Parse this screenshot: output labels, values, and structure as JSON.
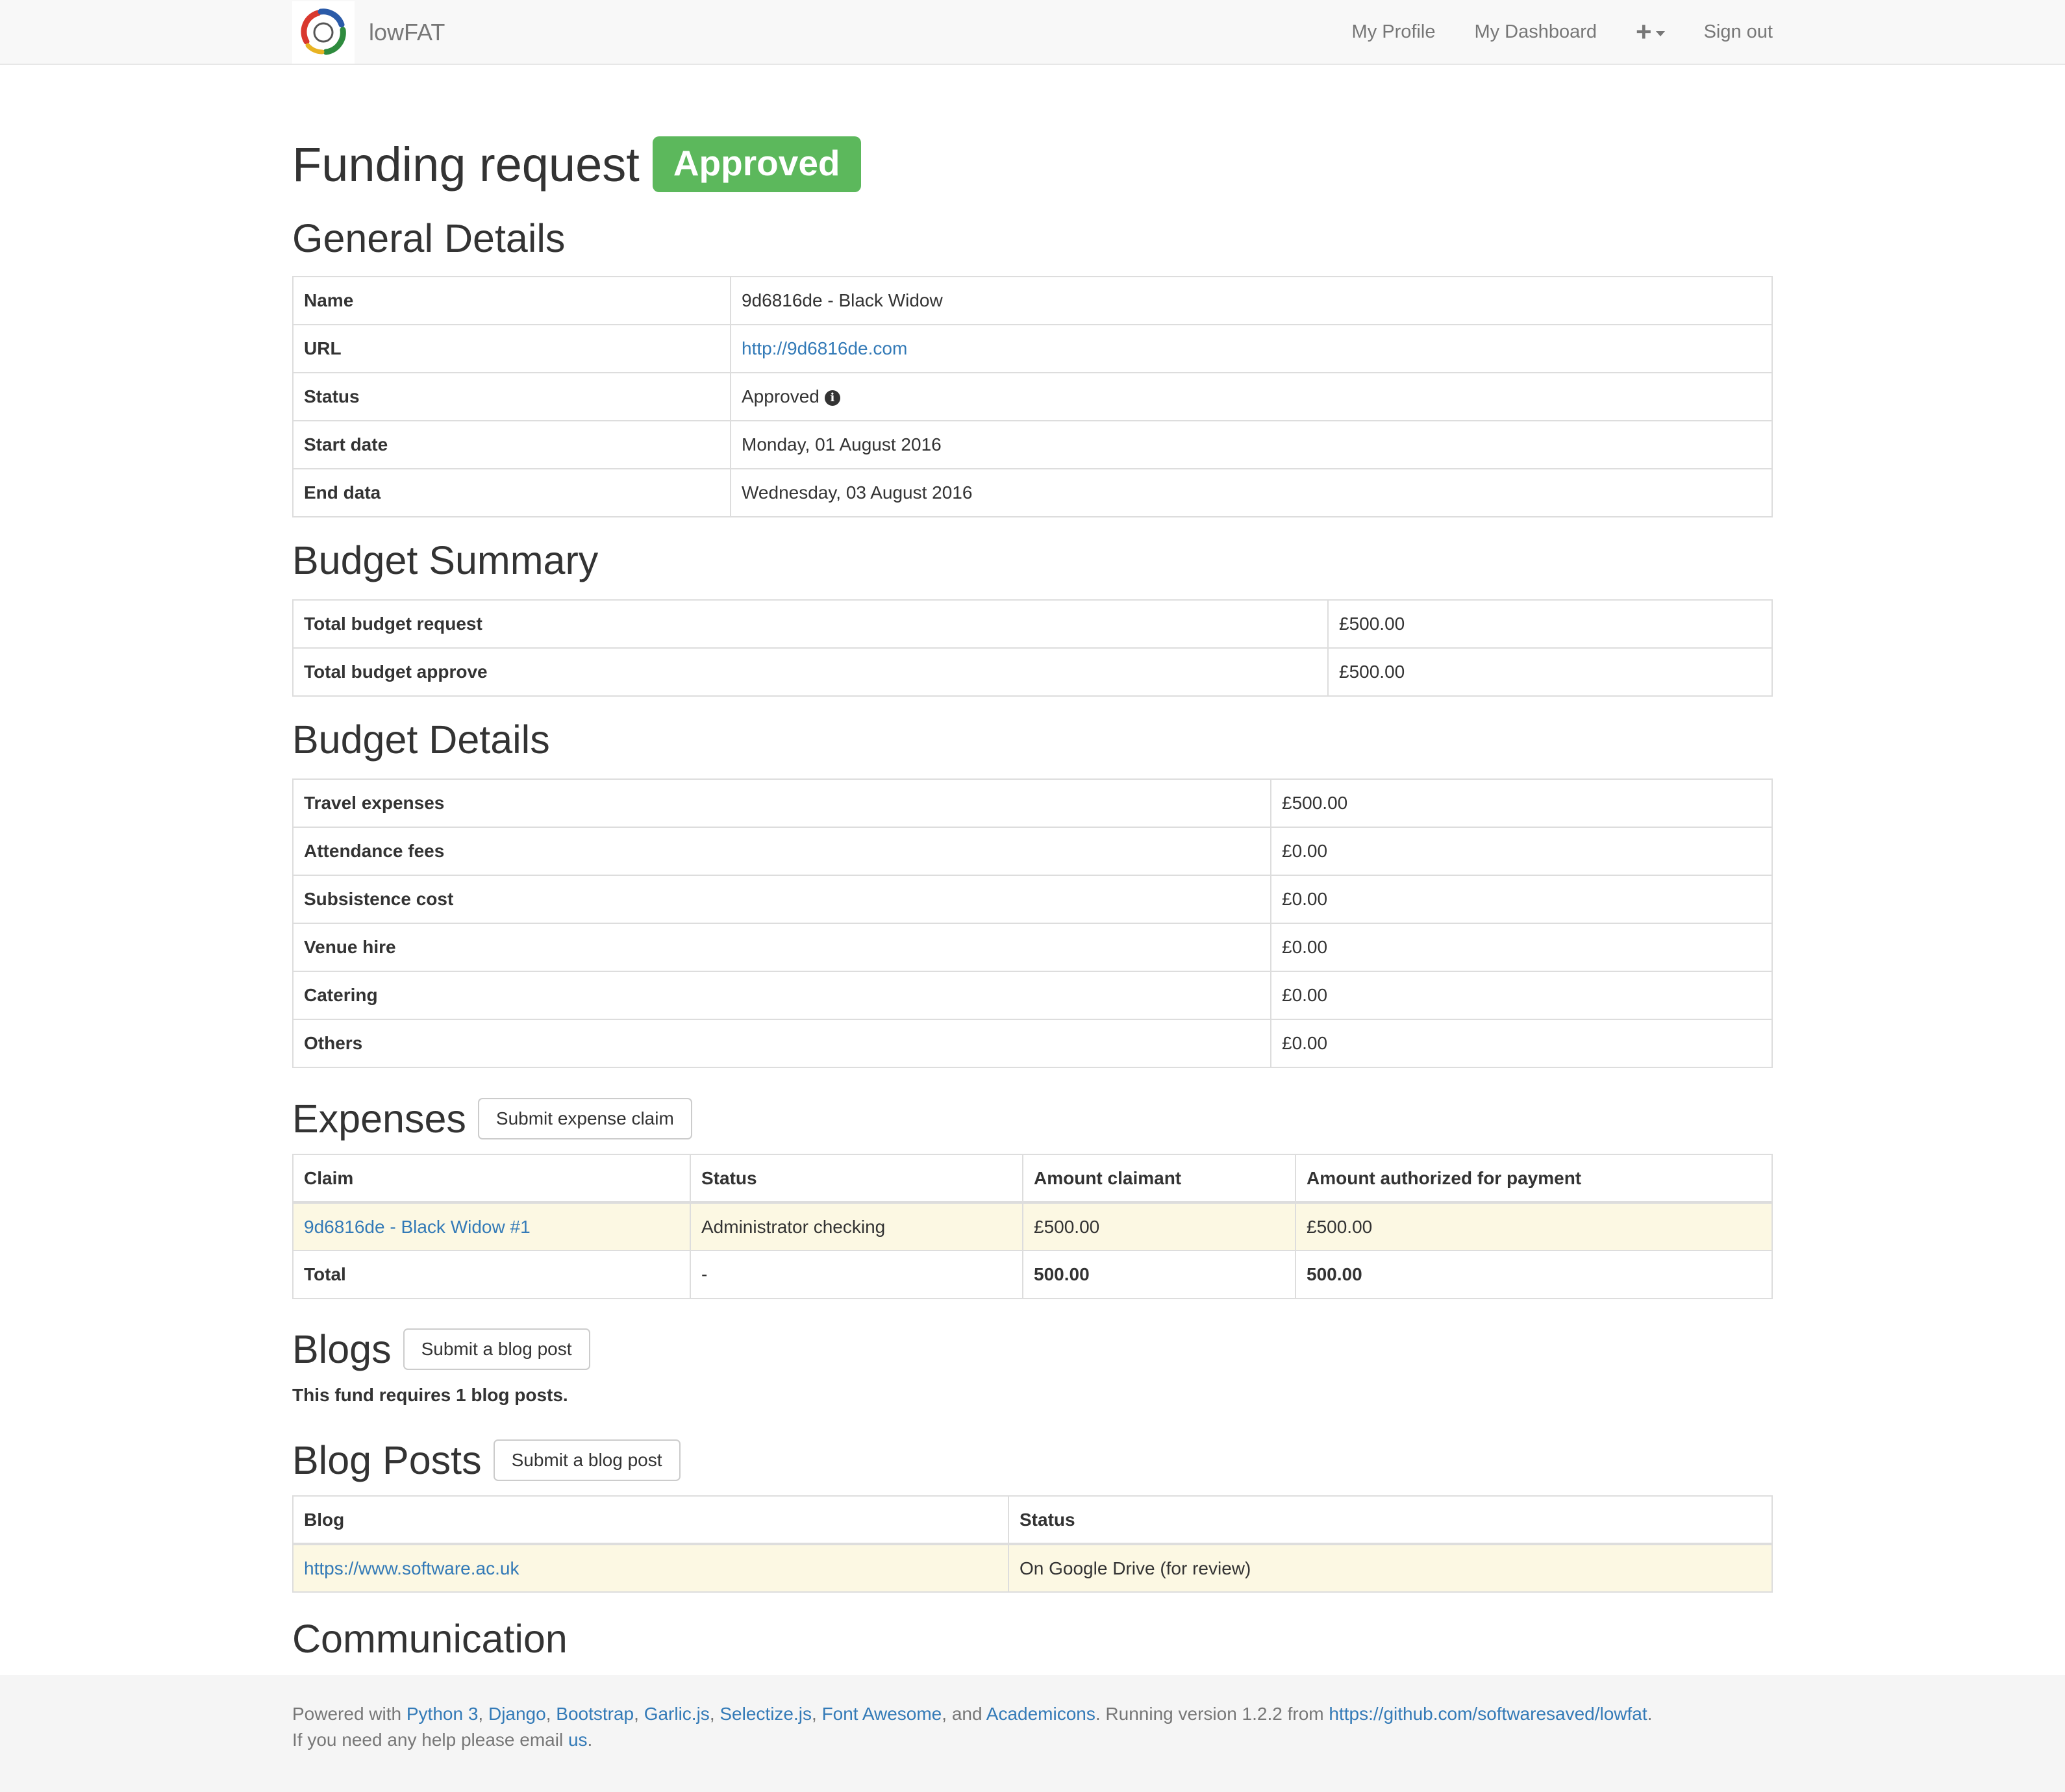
{
  "navbar": {
    "brand": "lowFAT",
    "items": [
      "My Profile",
      "My Dashboard",
      "Sign out"
    ]
  },
  "header": {
    "title": "Funding request",
    "status_badge": "Approved",
    "badge_color": "#5cb85c"
  },
  "general_details": {
    "heading": "General Details",
    "rows": [
      {
        "key": "Name",
        "value": "9d6816de - Black Widow"
      },
      {
        "key": "URL",
        "value": "http://9d6816de.com"
      },
      {
        "key": "Status",
        "value": "Approved"
      },
      {
        "key": "Start date",
        "value": "Monday, 01 August 2016"
      },
      {
        "key": "End data",
        "value": "Wednesday, 03 August 2016"
      }
    ]
  },
  "budget_summary": {
    "heading": "Budget Summary",
    "rows": [
      {
        "key": "Total budget request",
        "value": "£500.00"
      },
      {
        "key": "Total budget approve",
        "value": "£500.00"
      }
    ]
  },
  "budget_details": {
    "heading": "Budget Details",
    "rows": [
      {
        "key": "Travel expenses",
        "value": "£500.00"
      },
      {
        "key": "Attendance fees",
        "value": "£0.00"
      },
      {
        "key": "Subsistence cost",
        "value": "£0.00"
      },
      {
        "key": "Venue hire",
        "value": "£0.00"
      },
      {
        "key": "Catering",
        "value": "£0.00"
      },
      {
        "key": "Others",
        "value": "£0.00"
      }
    ]
  },
  "expenses": {
    "heading": "Expenses",
    "button": "Submit expense claim",
    "columns": [
      "Claim",
      "Status",
      "Amount claimant",
      "Amount authorized for payment"
    ],
    "rows": [
      {
        "claim": "9d6816de - Black Widow #1",
        "status": "Administrator checking",
        "claimed": "£500.00",
        "authorized": "£500.00"
      }
    ],
    "total": {
      "label": "Total",
      "status": "-",
      "claimed": "500.00",
      "authorized": "500.00"
    }
  },
  "blogs": {
    "heading": "Blogs",
    "button": "Submit a blog post",
    "note": "This fund requires 1 blog posts."
  },
  "blog_posts": {
    "heading": "Blog Posts",
    "button": "Submit a blog post",
    "columns": [
      "Blog",
      "Status"
    ],
    "rows": [
      {
        "blog": "https://www.software.ac.uk",
        "status": "On Google Drive (for review)"
      }
    ]
  },
  "communication": {
    "heading": "Communication"
  },
  "footer": {
    "powered_with": "Powered with",
    "links": [
      "Python 3",
      "Django",
      "Bootstrap",
      "Garlic.js",
      "Selectize.js",
      "Font Awesome",
      "Academicons"
    ],
    "and": ", and",
    "running": ". Running version 1.2.2 from",
    "repo": "https://github.com/softwaresaved/lowfat",
    "help_prefix": "If you need any help please email",
    "help_link": "us"
  }
}
